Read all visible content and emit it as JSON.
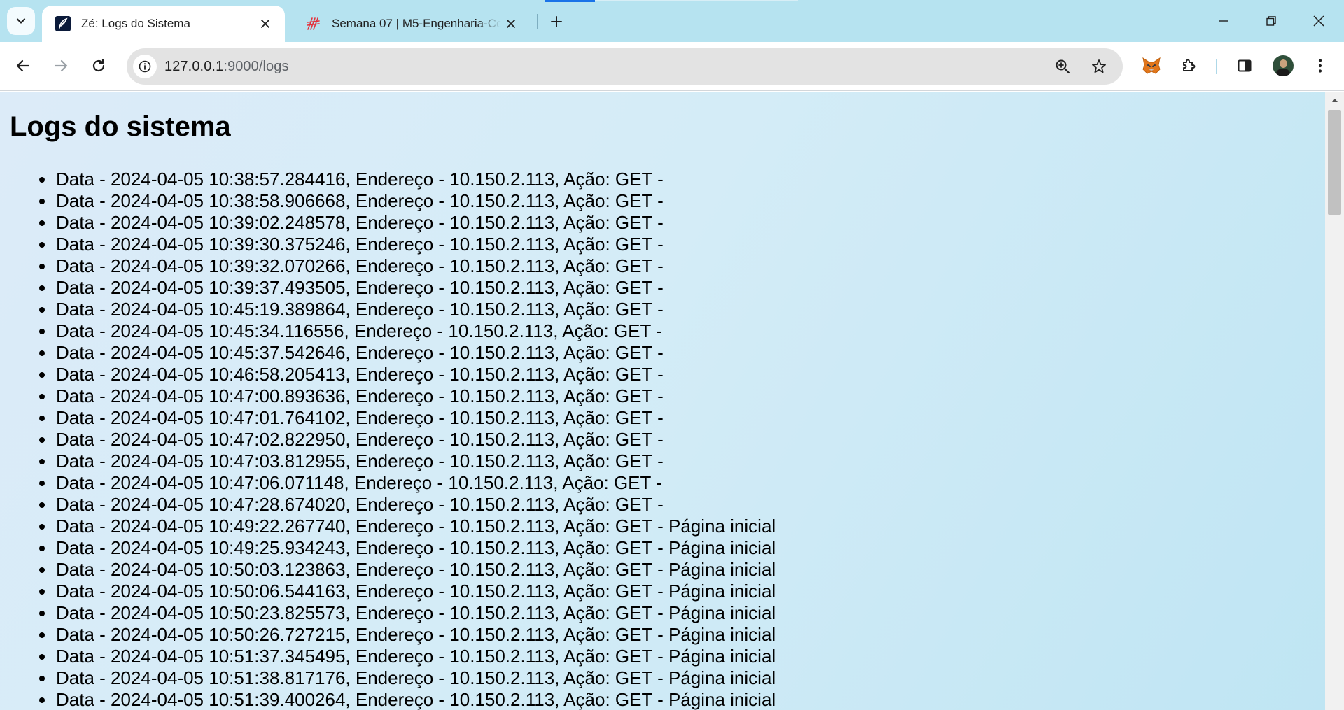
{
  "browser": {
    "tabs": [
      {
        "title": "Zé: Logs do Sistema",
        "favicon": "python-feather-icon",
        "active": true
      },
      {
        "title": "Semana 07 | M5-Engenharia-Co",
        "favicon": "inteli-logo-icon",
        "active": false
      }
    ],
    "address_bar": {
      "host": "127.0.0.1",
      "rest": ":9000/logs"
    },
    "colors": {
      "tabstrip": "#b6e3f0",
      "loading_accent": "#1a73e8"
    }
  },
  "page": {
    "title": "Logs do sistema",
    "logs": [
      "Data - 2024-04-05 10:38:57.284416, Endereço - 10.150.2.113, Ação: GET -",
      "Data - 2024-04-05 10:38:58.906668, Endereço - 10.150.2.113, Ação: GET -",
      "Data - 2024-04-05 10:39:02.248578, Endereço - 10.150.2.113, Ação: GET -",
      "Data - 2024-04-05 10:39:30.375246, Endereço - 10.150.2.113, Ação: GET -",
      "Data - 2024-04-05 10:39:32.070266, Endereço - 10.150.2.113, Ação: GET -",
      "Data - 2024-04-05 10:39:37.493505, Endereço - 10.150.2.113, Ação: GET -",
      "Data - 2024-04-05 10:45:19.389864, Endereço - 10.150.2.113, Ação: GET -",
      "Data - 2024-04-05 10:45:34.116556, Endereço - 10.150.2.113, Ação: GET -",
      "Data - 2024-04-05 10:45:37.542646, Endereço - 10.150.2.113, Ação: GET -",
      "Data - 2024-04-05 10:46:58.205413, Endereço - 10.150.2.113, Ação: GET -",
      "Data - 2024-04-05 10:47:00.893636, Endereço - 10.150.2.113, Ação: GET -",
      "Data - 2024-04-05 10:47:01.764102, Endereço - 10.150.2.113, Ação: GET -",
      "Data - 2024-04-05 10:47:02.822950, Endereço - 10.150.2.113, Ação: GET -",
      "Data - 2024-04-05 10:47:03.812955, Endereço - 10.150.2.113, Ação: GET -",
      "Data - 2024-04-05 10:47:06.071148, Endereço - 10.150.2.113, Ação: GET -",
      "Data - 2024-04-05 10:47:28.674020, Endereço - 10.150.2.113, Ação: GET -",
      "Data - 2024-04-05 10:49:22.267740, Endereço - 10.150.2.113, Ação: GET - Página inicial",
      "Data - 2024-04-05 10:49:25.934243, Endereço - 10.150.2.113, Ação: GET - Página inicial",
      "Data - 2024-04-05 10:50:03.123863, Endereço - 10.150.2.113, Ação: GET - Página inicial",
      "Data - 2024-04-05 10:50:06.544163, Endereço - 10.150.2.113, Ação: GET - Página inicial",
      "Data - 2024-04-05 10:50:23.825573, Endereço - 10.150.2.113, Ação: GET - Página inicial",
      "Data - 2024-04-05 10:50:26.727215, Endereço - 10.150.2.113, Ação: GET - Página inicial",
      "Data - 2024-04-05 10:51:37.345495, Endereço - 10.150.2.113, Ação: GET - Página inicial",
      "Data - 2024-04-05 10:51:38.817176, Endereço - 10.150.2.113, Ação: GET - Página inicial",
      "Data - 2024-04-05 10:51:39.400264, Endereço - 10.150.2.113, Ação: GET - Página inicial"
    ]
  }
}
